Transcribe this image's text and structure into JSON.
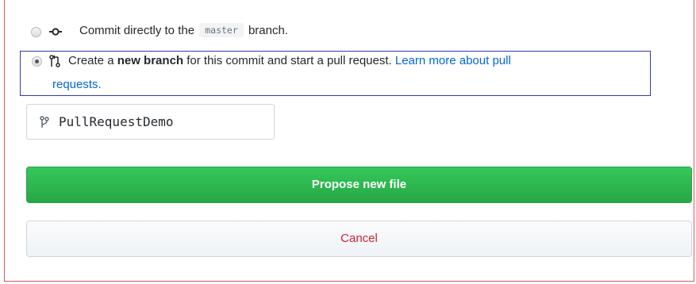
{
  "commit_options": {
    "direct": {
      "prefix": "Commit directly to the",
      "branch_code": "master",
      "suffix": "branch.",
      "selected": false,
      "icon": "git-commit-icon"
    },
    "new_branch": {
      "text_before": "Create a",
      "bold_text": "new branch",
      "text_after": "for this commit and start a pull request.",
      "link_line1": "Learn more about pull",
      "link_line2": "requests.",
      "selected": true,
      "icon": "git-pull-request-icon"
    }
  },
  "branch_name": {
    "value": "PullRequestDemo",
    "icon": "git-branch-icon"
  },
  "buttons": {
    "propose_label": "Propose new file",
    "cancel_label": "Cancel"
  },
  "colors": {
    "primary_green": "#28a745",
    "link_blue": "#0366d6",
    "cancel_red": "#cb2431",
    "highlight_border": "#2f3bb0"
  }
}
